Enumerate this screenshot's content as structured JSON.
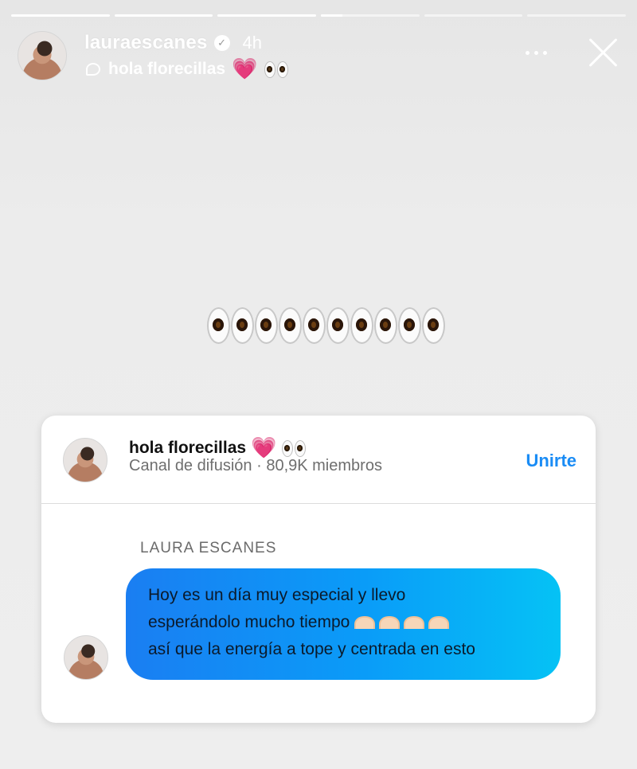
{
  "progress": {
    "segments": [
      1,
      1,
      1,
      0.22,
      0,
      0
    ]
  },
  "header": {
    "username": "lauraescanes",
    "verified_mark": "✓",
    "time_ago": "4h",
    "channel_name": "hola florecillas",
    "heart": "💗",
    "icons": [
      "channel-icon",
      "verified-icon",
      "more-icon",
      "close-icon"
    ]
  },
  "story": {
    "eye_count": 10
  },
  "card": {
    "title": "hola florecillas",
    "heart": "💗",
    "subtitle": "Canal de difusión · 80,9K miembros",
    "join_label": "Unirte",
    "join_color": "#1a8cf5",
    "sender": "LAURA ESCANES",
    "message_lines": [
      "Hoy es un día muy especial y llevo",
      "esperándolo mucho tiempo",
      "así que la energía a tope y centrada en esto"
    ],
    "bubble_colors": [
      "#1a7ef2",
      "#05c2f5"
    ]
  }
}
